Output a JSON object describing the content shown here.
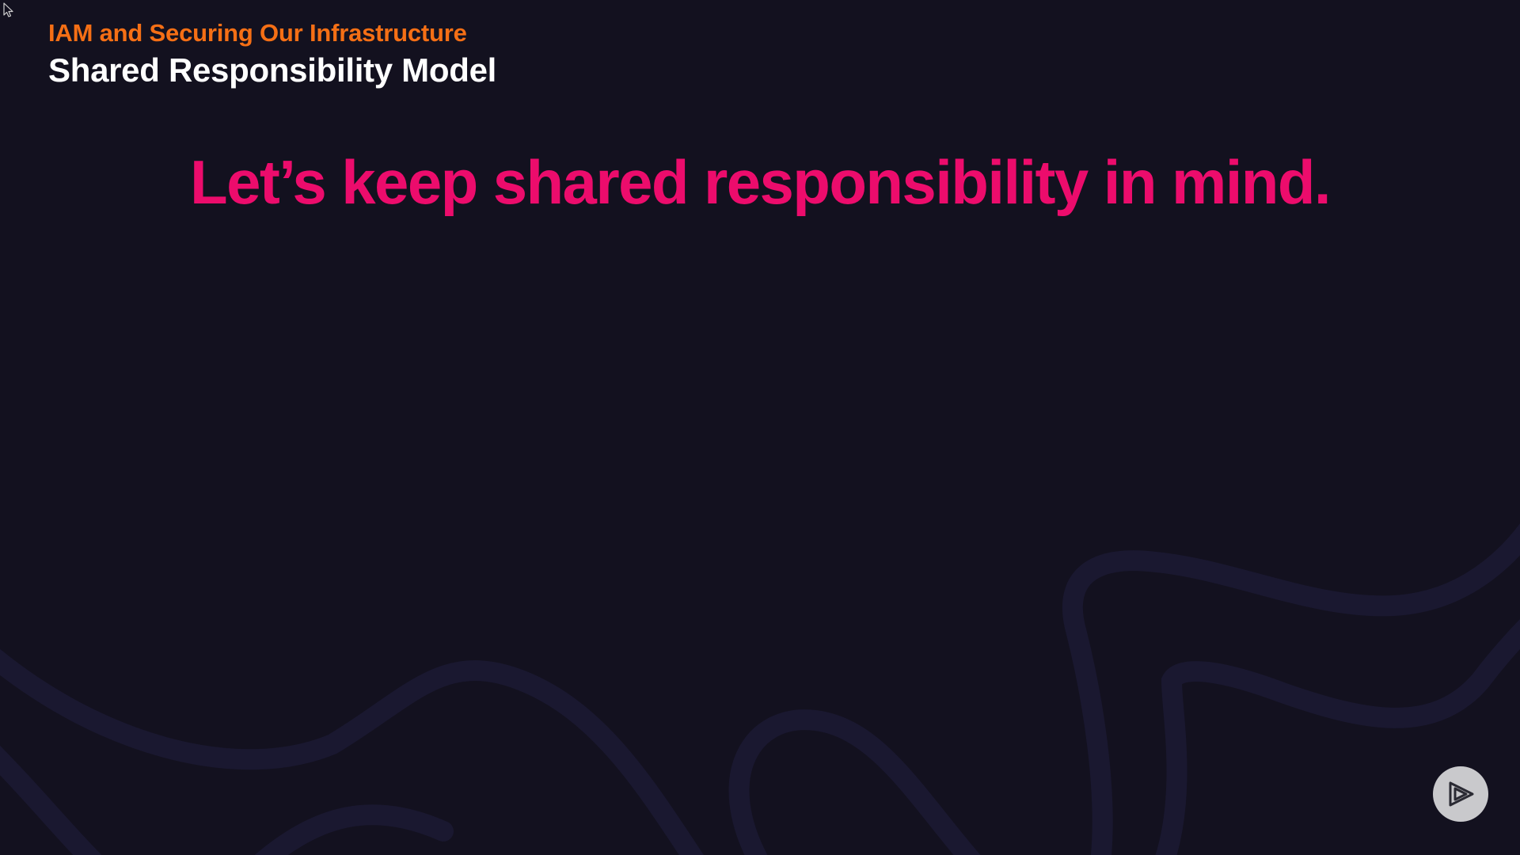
{
  "colors": {
    "background": "#13111f",
    "module_title": "#f56f15",
    "clip_title": "#ffffff",
    "headline": "#ec0c6c",
    "waves": "#1a1830",
    "play_button_bg": "#c9c9cc",
    "play_icon": "#2a2a33"
  },
  "header": {
    "module_title": "IAM and Securing Our Infrastructure",
    "clip_title": "Shared Responsibility Model"
  },
  "slide": {
    "headline": "Let’s keep shared responsibility in mind."
  },
  "icons": {
    "cursor": "mouse-pointer-icon",
    "player": "pluralsight-play-icon"
  }
}
